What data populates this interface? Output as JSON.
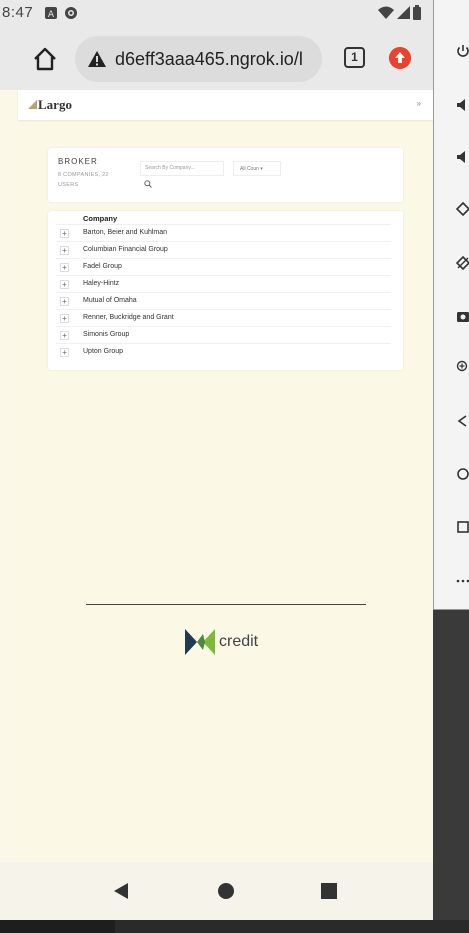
{
  "status_bar": {
    "time": "8:47"
  },
  "browser": {
    "url": "d6eff3aaa465.ngrok.io/l",
    "tab_count": "1"
  },
  "site": {
    "logo_text": "Largo",
    "menu_toggle": "»"
  },
  "broker": {
    "title": "BROKER",
    "subtitle": "8 COMPANIES, 22 USERS",
    "search_placeholder": "Search By Company...",
    "country_select": "All Coun ▾"
  },
  "table": {
    "column_header": "Company",
    "expander_symbol": "+",
    "rows": [
      "Barton, Beier and Kuhlman",
      "Columbian Financial Group",
      "Fadel Group",
      "Haley-Hintz",
      "Mutual of Omaha",
      "Renner, Buckridge and Grant",
      "Simonis Group",
      "Upton Group"
    ]
  },
  "footer": {
    "brand_text": "credit"
  },
  "colors": {
    "page_bg": "#fbf8e6",
    "accent_logo": "#b7a46d",
    "update_red": "#e8432f",
    "credit_dark": "#1f3b4d",
    "credit_green": "#7fb83a"
  }
}
